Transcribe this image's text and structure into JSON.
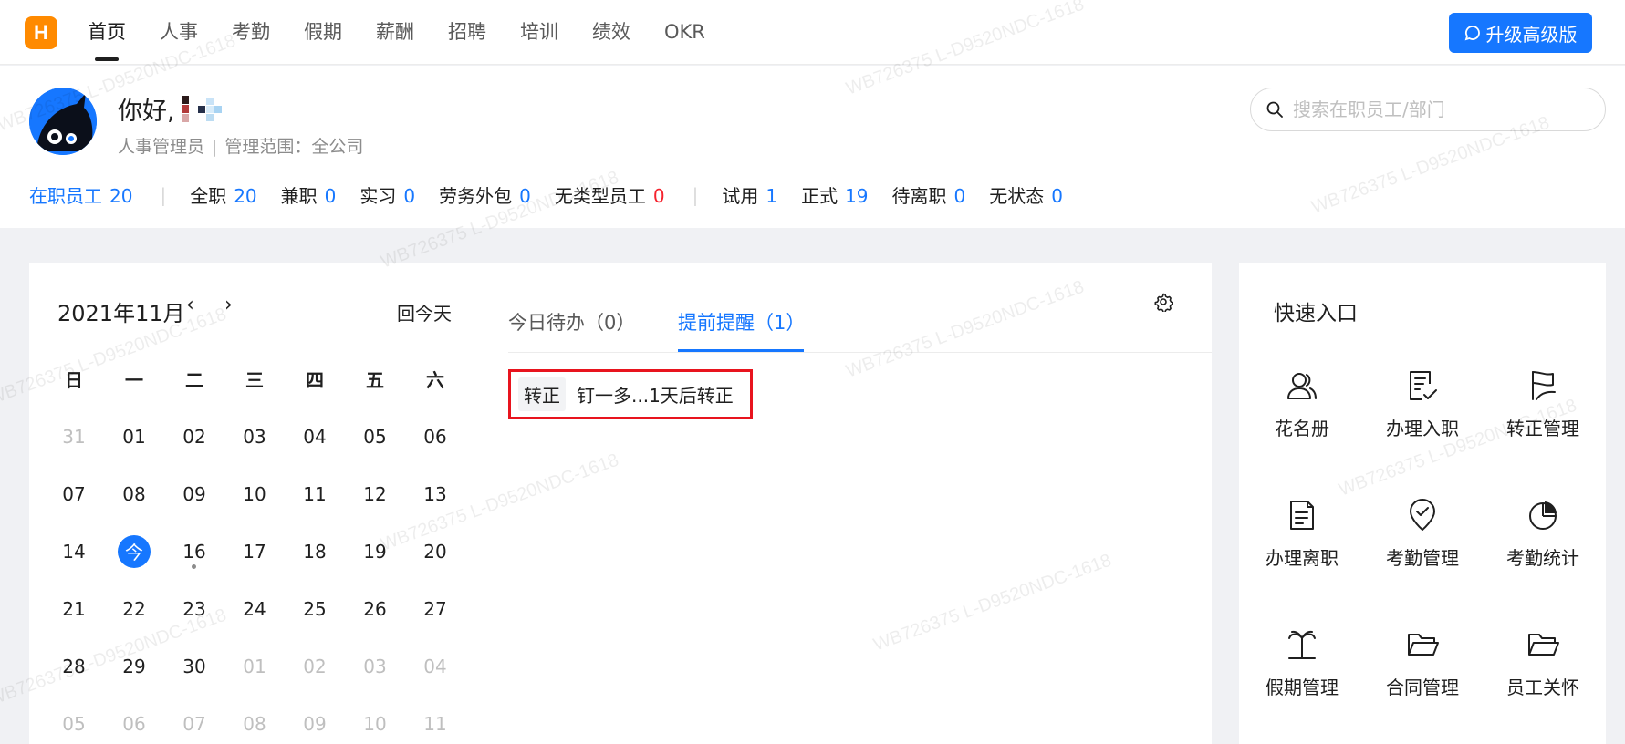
{
  "app": {
    "logo_letter": "H"
  },
  "nav": {
    "items": [
      {
        "label": "首页",
        "active": true
      },
      {
        "label": "人事"
      },
      {
        "label": "考勤"
      },
      {
        "label": "假期"
      },
      {
        "label": "薪酬"
      },
      {
        "label": "招聘"
      },
      {
        "label": "培训"
      },
      {
        "label": "绩效"
      },
      {
        "label": "OKR"
      }
    ],
    "upgrade_label": "升级高级版"
  },
  "profile": {
    "greeting": "你好,",
    "role": "人事管理员",
    "scope": "管理范围：全公司"
  },
  "search": {
    "placeholder": "搜索在职员工/部门"
  },
  "stats": [
    {
      "label": "在职员工",
      "value": "20"
    },
    {
      "label": "全职",
      "value": "20"
    },
    {
      "label": "兼职",
      "value": "0"
    },
    {
      "label": "实习",
      "value": "0"
    },
    {
      "label": "劳务外包",
      "value": "0"
    },
    {
      "label": "无类型员工",
      "value": "0"
    },
    {
      "label": "试用",
      "value": "1"
    },
    {
      "label": "正式",
      "value": "19"
    },
    {
      "label": "待离职",
      "value": "0"
    },
    {
      "label": "无状态",
      "value": "0"
    }
  ],
  "calendar": {
    "title": "2021年11月",
    "prev": "‹",
    "next": "›",
    "today_label": "回今天",
    "weekdays": [
      "日",
      "一",
      "二",
      "三",
      "四",
      "五",
      "六"
    ],
    "weeks": [
      [
        "31",
        "01",
        "02",
        "03",
        "04",
        "05",
        "06"
      ],
      [
        "07",
        "08",
        "09",
        "10",
        "11",
        "12",
        "13"
      ],
      [
        "14",
        "今",
        "16",
        "17",
        "18",
        "19",
        "20"
      ],
      [
        "21",
        "22",
        "23",
        "24",
        "25",
        "26",
        "27"
      ],
      [
        "28",
        "29",
        "30",
        "01",
        "02",
        "03",
        "04"
      ],
      [
        "05",
        "06",
        "07",
        "08",
        "09",
        "10",
        "11"
      ]
    ]
  },
  "tabs": [
    {
      "label": "今日待办（0）"
    },
    {
      "label": "提前提醒（1）",
      "active": true
    }
  ],
  "reminder": {
    "tag": "转正",
    "text": "钉一多...1天后转正"
  },
  "quick": {
    "title": "快速入口",
    "items": [
      {
        "label": "花名册",
        "icon": "roster-icon"
      },
      {
        "label": "办理入职",
        "icon": "onboard-icon"
      },
      {
        "label": "转正管理",
        "icon": "regularize-icon"
      },
      {
        "label": "办理离职",
        "icon": "offboard-icon"
      },
      {
        "label": "考勤管理",
        "icon": "attendance-icon"
      },
      {
        "label": "考勤统计",
        "icon": "attendance-stats-icon"
      },
      {
        "label": "假期管理",
        "icon": "holiday-icon"
      },
      {
        "label": "合同管理",
        "icon": "contract-folder-icon"
      },
      {
        "label": "员工关怀",
        "icon": "care-folder-icon"
      }
    ]
  },
  "watermark": "WB726375 L-D9520NDC-1618",
  "colors": {
    "accent": "#1677ff",
    "logo": "#ff8a00",
    "danger": "#f5222d",
    "highlight_border": "#e8141e"
  }
}
